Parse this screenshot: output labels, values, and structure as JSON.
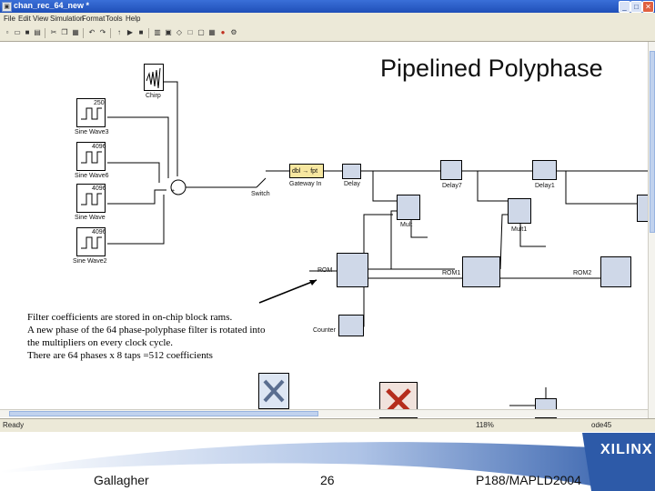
{
  "window": {
    "title": "chan_rec_64_new *",
    "buttons": [
      "_",
      "□",
      "✕"
    ]
  },
  "menu": [
    "File",
    "Edit",
    "View",
    "Simulation",
    "Format",
    "Tools",
    "Help"
  ],
  "toolbar": {
    "zoom": "100%"
  },
  "slide": {
    "title": "Pipelined Polyphase"
  },
  "diagram": {
    "sources": [
      {
        "label": "Chirp",
        "icon": "chirp"
      },
      {
        "label": "Sine Wave3",
        "tag": "250"
      },
      {
        "label": "Sine Wave6",
        "tag": "4096"
      },
      {
        "label": "Sine Wave",
        "tag": "4096"
      },
      {
        "label": "Sine Wave2",
        "tag": "4096"
      }
    ],
    "switch_label": "Switch",
    "gateway_label": "Gateway In",
    "gateway_text": "dbl → fpt",
    "delay_labels": [
      "Delay",
      "Delay7",
      "Delay1"
    ],
    "mult_labels": [
      "Mult",
      "Mult1"
    ],
    "rom_labels": [
      "ROM",
      "ROM1",
      "ROM2"
    ],
    "counter_label": "Counter"
  },
  "annotation": {
    "lines": [
      "Filter coefficients are stored in on-chip block rams.",
      "A new phase of the 64 phase-polyphase filter is rotated into",
      "the multipliers on every clock cycle.",
      "There are 64 phases x 8 taps =512 coefficients"
    ]
  },
  "status": {
    "left": "Ready",
    "zoom": "118%",
    "mode": "ode45"
  },
  "footer": {
    "author": "Gallagher",
    "page": "26",
    "reference": "P188/MAPLD2004",
    "logo": "XILINX"
  },
  "colors": {
    "titlebar": "#2b5fc8",
    "chrome": "#ece9d8",
    "gateway_fill": "#f7e7a0",
    "xilinx_red": "#b52c1c",
    "footer_wave": "#2d5aa8"
  }
}
